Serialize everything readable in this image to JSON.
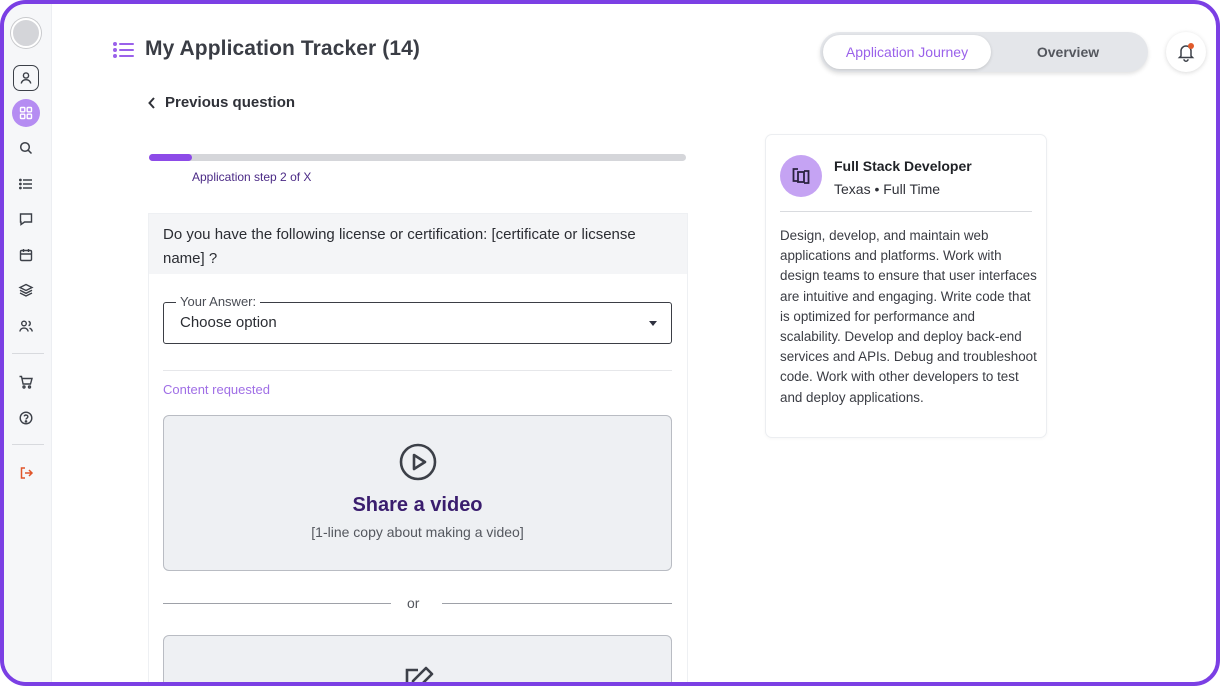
{
  "header": {
    "title": "My Application Tracker (14)",
    "tabs": [
      {
        "label": "Application Journey",
        "active": true
      },
      {
        "label": "Overview",
        "active": false
      }
    ]
  },
  "sidebar": {
    "items": [
      {
        "name": "profile",
        "icon": "user-icon"
      },
      {
        "name": "dashboard",
        "icon": "grid-icon",
        "active": true
      },
      {
        "name": "search",
        "icon": "search-icon"
      },
      {
        "name": "list",
        "icon": "list-icon"
      },
      {
        "name": "messages",
        "icon": "chat-icon"
      },
      {
        "name": "calendar",
        "icon": "calendar-icon"
      },
      {
        "name": "layers",
        "icon": "layers-icon"
      },
      {
        "name": "people",
        "icon": "users-icon"
      },
      {
        "name": "cart",
        "icon": "cart-icon"
      },
      {
        "name": "help",
        "icon": "help-icon"
      },
      {
        "name": "logout",
        "icon": "logout-icon"
      }
    ]
  },
  "nav": {
    "previous_label": "Previous question"
  },
  "progress": {
    "label": "Application step 2 of X",
    "value": 0.08
  },
  "question": {
    "text": "Do you have the following license or certification: [certificate or licsense name] ?",
    "answer_label": "Your Answer:",
    "answer_value": "Choose option",
    "content_requested_label": "Content requested",
    "video": {
      "title": "Share a video",
      "subtitle": "[1-line copy about making a video]"
    },
    "or_label": "or"
  },
  "job": {
    "title": "Full Stack Developer",
    "meta": "Texas • Full Time",
    "description": "Design, develop, and maintain web applications and platforms. Work with design teams to ensure that user interfaces are intuitive and engaging. Write code that is optimized for performance and scalability. Develop and deploy back-end services and APIs. Debug and troubleshoot code. Work with other developers to test and deploy applications."
  },
  "colors": {
    "frame": "#7b3fe4",
    "accent": "#8d4be8",
    "accent_light": "#b58cf2",
    "heading_dark": "#3a1d6e",
    "notification": "#e05a2b"
  }
}
